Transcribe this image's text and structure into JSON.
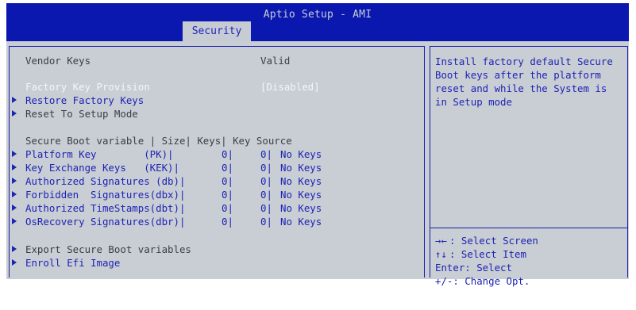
{
  "header": {
    "title": "Aptio Setup - AMI",
    "active_tab": "Security"
  },
  "main": {
    "vendor_keys": {
      "label": "Vendor Keys",
      "value": "Valid"
    },
    "factory_key_provision": {
      "label": "Factory Key Provision",
      "value": "[Disabled]"
    },
    "restore_factory_keys": "Restore Factory Keys",
    "reset_to_setup_mode": "Reset To Setup Mode",
    "table_header": "Secure Boot variable | Size| Keys| Key Source",
    "variables": [
      {
        "name": "Platform Key        (PK)|",
        "size": "0|",
        "keys": "0|",
        "source": "No Keys"
      },
      {
        "name": "Key Exchange Keys   (KEK)|",
        "size": "0|",
        "keys": "0|",
        "source": "No Keys"
      },
      {
        "name": "Authorized Signatures (db)|",
        "size": "0|",
        "keys": "0|",
        "source": "No Keys"
      },
      {
        "name": "Forbidden  Signatures(dbx)|",
        "size": "0|",
        "keys": "0|",
        "source": "No Keys"
      },
      {
        "name": "Authorized TimeStamps(dbt)|",
        "size": "0|",
        "keys": "0|",
        "source": "No Keys"
      },
      {
        "name": "OsRecovery Signatures(dbr)|",
        "size": "0|",
        "keys": "0|",
        "source": "No Keys"
      }
    ],
    "export_secure_boot_variables": "Export Secure Boot variables",
    "enroll_efi_image": "Enroll Efi Image"
  },
  "help": {
    "lines": [
      "Install factory default Secure",
      "Boot keys after the platform",
      "reset and while the System is",
      "in Setup mode"
    ]
  },
  "keys_legend": [
    {
      "glyph": "→←",
      "text": ": Select Screen"
    },
    {
      "glyph": "↑↓",
      "text": ": Select Item"
    },
    {
      "glyph": "",
      "text": "Enter: Select"
    },
    {
      "glyph": "",
      "text": "+/-: Change Opt."
    }
  ],
  "colors": {
    "header_bg": "#0a18b0",
    "panel_bg": "#c9cdd4",
    "accent_blue": "#1c24b4",
    "highlight_white": "#f4f6fa",
    "text_dark": "#3b3f45"
  }
}
